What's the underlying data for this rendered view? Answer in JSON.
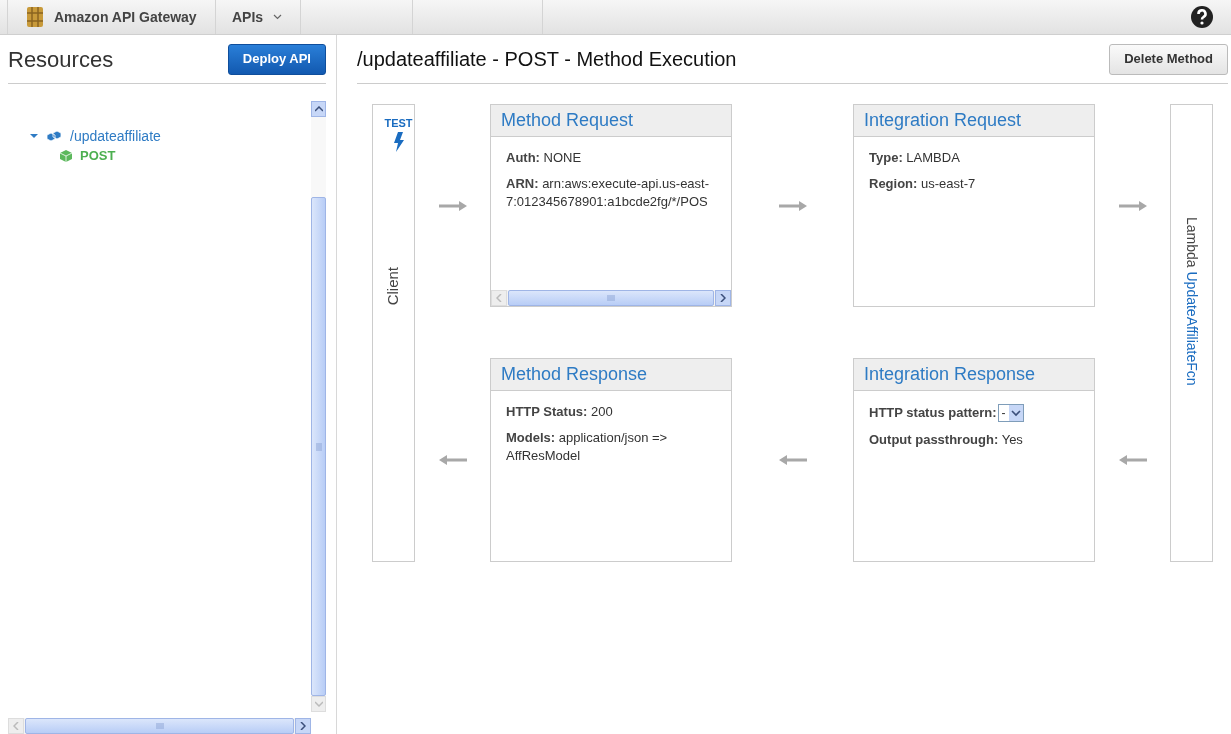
{
  "top_bar": {
    "brand": "Amazon API Gateway",
    "menus": [
      {
        "label": "APIs"
      }
    ]
  },
  "sidebar": {
    "title": "Resources",
    "deploy_button": "Deploy API",
    "tree": [
      {
        "label": "/updateaffiliate",
        "expanded": true,
        "children": [
          {
            "label": "POST"
          }
        ]
      }
    ]
  },
  "main": {
    "title": "/updateaffiliate - POST - Method Execution",
    "delete_button": "Delete Method",
    "client": {
      "test_label": "TEST",
      "label": "Client"
    },
    "boxes": [
      {
        "title": "Method Request",
        "scrollbar": true,
        "fields": [
          {
            "kind": "text",
            "label": "Auth:",
            "value": "NONE"
          },
          {
            "kind": "text",
            "label": "ARN:",
            "value": "arn:aws:execute-api.us-east-7:012345678901:a1bcde2fg/*/POS"
          }
        ]
      },
      {
        "title": "Integration Request",
        "scrollbar": false,
        "fields": [
          {
            "kind": "text",
            "label": "Type:",
            "value": "LAMBDA"
          },
          {
            "kind": "text",
            "label": "Region:",
            "value": "us-east-7"
          }
        ]
      },
      {
        "title": "Method Response",
        "scrollbar": false,
        "fields": [
          {
            "kind": "text",
            "label": "HTTP Status:",
            "value": "200"
          },
          {
            "kind": "text",
            "label": "Models:",
            "value": "application/json => AffResModel"
          }
        ]
      },
      {
        "title": "Integration Response",
        "scrollbar": false,
        "fields": [
          {
            "kind": "select",
            "label": "HTTP status pattern:",
            "option": "-"
          },
          {
            "kind": "text",
            "label": "Output passthrough:",
            "value": "Yes"
          }
        ]
      }
    ],
    "lambda": {
      "prefix": "Lambda",
      "function": "UpdateAffiliateFcn"
    }
  }
}
